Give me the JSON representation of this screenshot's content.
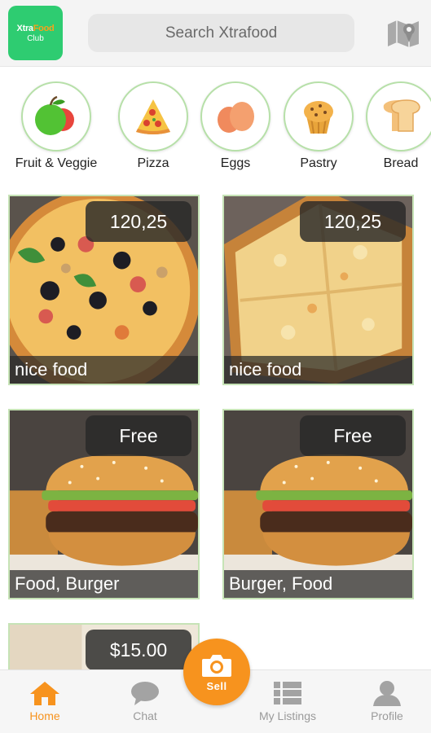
{
  "header": {
    "logo": {
      "line1_part1": "Xtra",
      "line1_part2": "Food",
      "line2": "Club"
    },
    "search_placeholder": "Search Xtrafood",
    "map_icon": "map-icon"
  },
  "categories": [
    {
      "label": "Fruit & Veggie",
      "icon": "fruit-icon"
    },
    {
      "label": "Pizza",
      "icon": "pizza-icon"
    },
    {
      "label": "Eggs",
      "icon": "eggs-icon"
    },
    {
      "label": "Pastry",
      "icon": "pastry-icon"
    },
    {
      "label": "Bread",
      "icon": "bread-icon"
    }
  ],
  "listings": [
    {
      "price": "120,25",
      "title": "nice food",
      "image": "pizza-photo"
    },
    {
      "price": "120,25",
      "title": "nice food",
      "image": "cheese-pizza-photo"
    },
    {
      "price": "Free",
      "title": "Food, Burger",
      "image": "burger-photo"
    },
    {
      "price": "Free",
      "title": "Burger, Food",
      "image": "burger-photo"
    },
    {
      "price": "$15.00",
      "title": "",
      "image": "item-photo"
    }
  ],
  "bottom_nav": {
    "home": "Home",
    "chat": "Chat",
    "sell": "Sell",
    "my_listings": "My Listings",
    "profile": "Profile"
  },
  "colors": {
    "accent": "#f7931e",
    "brand_green": "#2ecc71",
    "card_border": "#c6e3b6"
  }
}
